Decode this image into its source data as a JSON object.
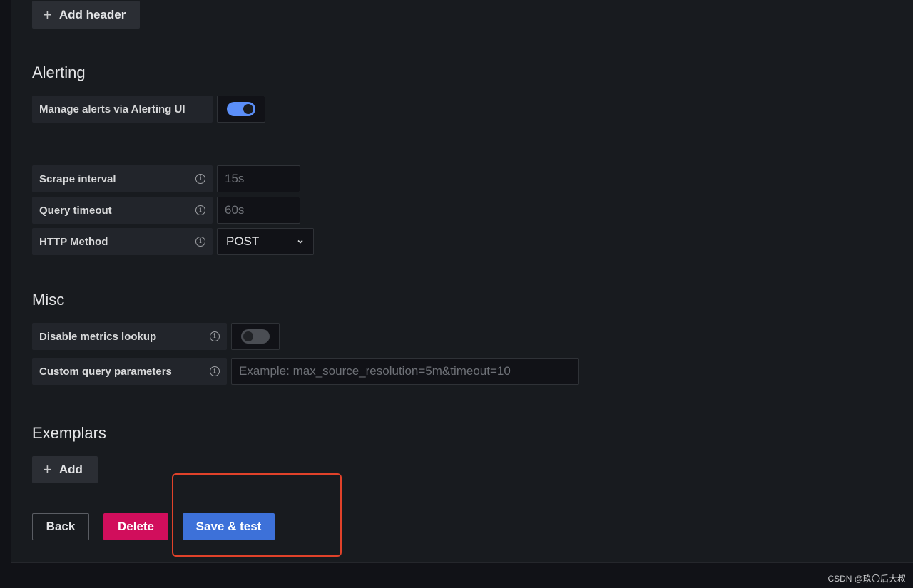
{
  "headers": {
    "add_header_label": "Add header"
  },
  "alerting": {
    "title": "Alerting",
    "manage_alerts_label": "Manage alerts via Alerting UI",
    "manage_alerts_enabled": true
  },
  "prometheus": {
    "scrape_interval_label": "Scrape interval",
    "scrape_interval_placeholder": "15s",
    "query_timeout_label": "Query timeout",
    "query_timeout_placeholder": "60s",
    "http_method_label": "HTTP Method",
    "http_method_value": "POST"
  },
  "misc": {
    "title": "Misc",
    "disable_metrics_label": "Disable metrics lookup",
    "disable_metrics_enabled": false,
    "custom_params_label": "Custom query parameters",
    "custom_params_placeholder": "Example: max_source_resolution=5m&timeout=10"
  },
  "exemplars": {
    "title": "Exemplars",
    "add_label": "Add"
  },
  "actions": {
    "back": "Back",
    "delete": "Delete",
    "save_test": "Save & test"
  },
  "watermark": "CSDN @玖〇后大叔",
  "colors": {
    "primary": "#3d71d9",
    "destructive": "#d10e5c",
    "highlight": "#e0422a",
    "toggle_on": "#5b8ff9"
  },
  "icons": {
    "info": "info-icon",
    "plus": "plus-icon",
    "chevron": "chevron-down-icon"
  }
}
